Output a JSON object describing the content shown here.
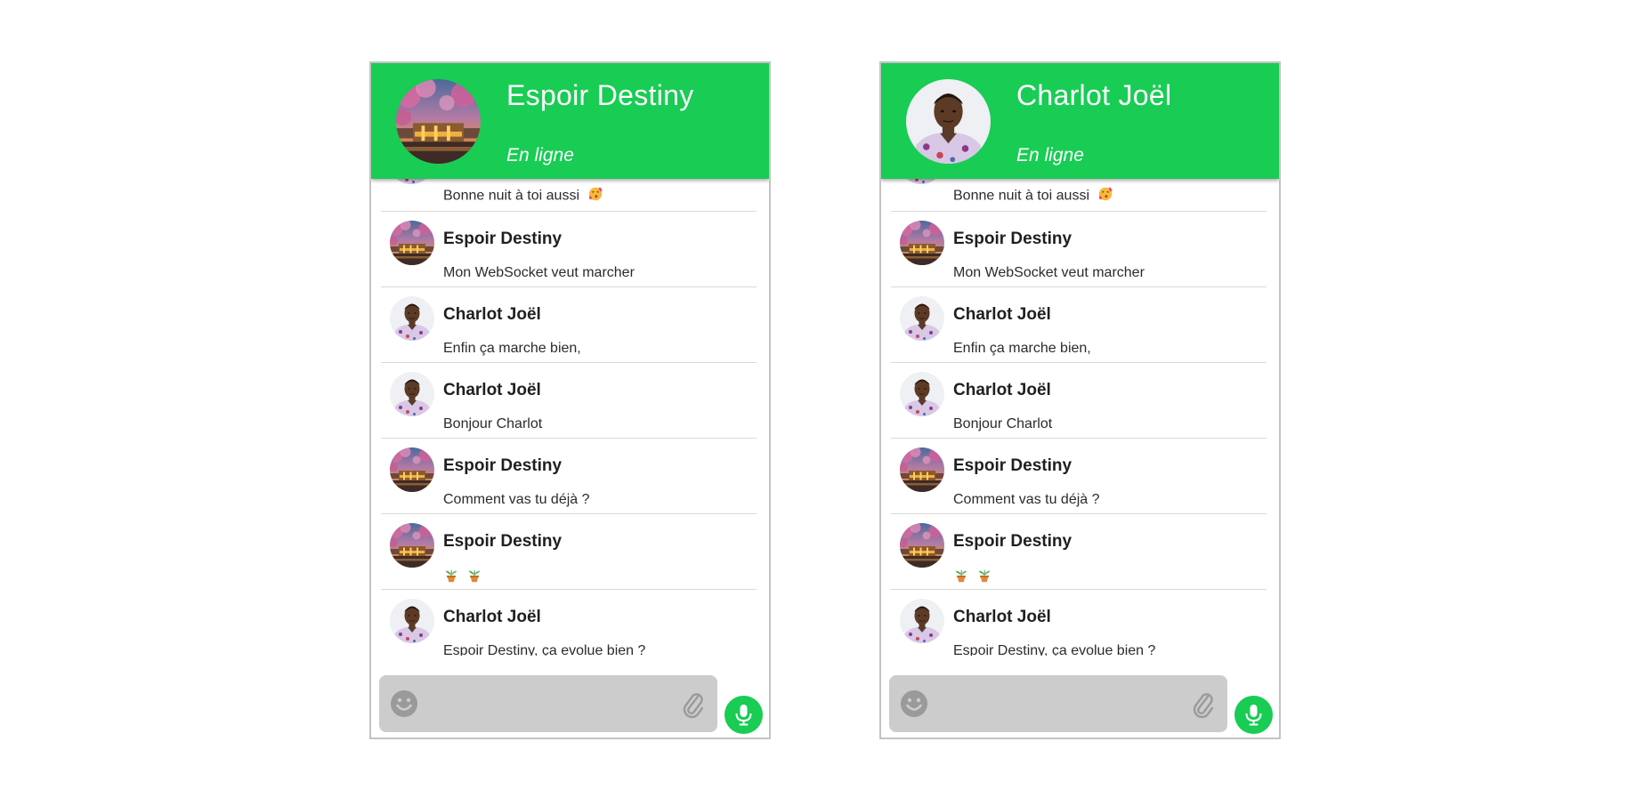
{
  "windows": [
    {
      "header": {
        "name": "Espoir Destiny",
        "status": "En ligne",
        "avatar": "destiny-avatar"
      },
      "messages": {
        "first_text": "Bonne nuit à toi aussi",
        "items": [
          {
            "sender": "Espoir Destiny",
            "text": "Mon WebSocket veut marcher",
            "avatar": "destiny-avatar"
          },
          {
            "sender": "Charlot Joël",
            "text": "Enfin ça marche bien,",
            "avatar": "charlot-avatar"
          },
          {
            "sender": "Charlot Joël",
            "text": "Bonjour Charlot",
            "avatar": "charlot-avatar"
          },
          {
            "sender": "Espoir Destiny",
            "text": "Comment vas tu déjà ?",
            "avatar": "destiny-avatar"
          },
          {
            "sender": "Espoir Destiny",
            "text": "",
            "avatar": "destiny-avatar"
          },
          {
            "sender": "Charlot Joël",
            "text": "Espoir Destiny, ça evolue bien ?",
            "avatar": "charlot-avatar"
          }
        ]
      },
      "composer": {
        "emoji_icon": "smiley-icon",
        "attach_icon": "paperclip-icon",
        "send_icon": "microphone-icon"
      }
    },
    {
      "header": {
        "name": "Charlot Joël",
        "status": "En ligne",
        "avatar": "charlot-avatar"
      },
      "messages": {
        "first_text": "Bonne nuit à toi aussi",
        "items": [
          {
            "sender": "Espoir Destiny",
            "text": "Mon WebSocket veut marcher",
            "avatar": "destiny-avatar"
          },
          {
            "sender": "Charlot Joël",
            "text": "Enfin ça marche bien,",
            "avatar": "charlot-avatar"
          },
          {
            "sender": "Charlot Joël",
            "text": "Bonjour Charlot",
            "avatar": "charlot-avatar"
          },
          {
            "sender": "Espoir Destiny",
            "text": "Comment vas tu déjà ?",
            "avatar": "destiny-avatar"
          },
          {
            "sender": "Espoir Destiny",
            "text": "",
            "avatar": "destiny-avatar"
          },
          {
            "sender": "Charlot Joël",
            "text": "Espoir Destiny, ça evolue bien ?",
            "avatar": "charlot-avatar"
          }
        ]
      },
      "composer": {
        "emoji_icon": "smiley-icon",
        "attach_icon": "paperclip-icon",
        "send_icon": "microphone-icon"
      }
    }
  ],
  "colors": {
    "header_green": "#18cc54",
    "composer_gray": "#cccccc",
    "icon_gray": "#8f8f8f",
    "divider": "#d9d9d9",
    "window_border": "#c3c3c3"
  }
}
